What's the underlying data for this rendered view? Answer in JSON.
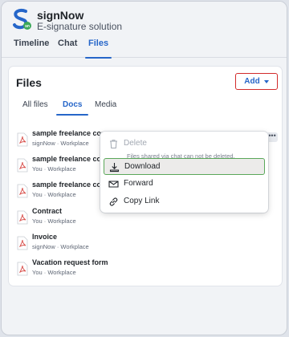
{
  "header": {
    "title": "signNow",
    "subtitle": "E-signature solution",
    "logo_icon": "signnow-logo-icon"
  },
  "tabs": [
    {
      "label": "Timeline",
      "active": false
    },
    {
      "label": "Chat",
      "active": false
    },
    {
      "label": "Files",
      "active": true
    }
  ],
  "files_card": {
    "title": "Files",
    "add_label": "Add",
    "subtabs": [
      {
        "label": "All files",
        "active": false
      },
      {
        "label": "Docs",
        "active": true
      },
      {
        "label": "Media",
        "active": false
      }
    ],
    "files": [
      {
        "name": "sample freelance cor",
        "meta": "signNow · Workplace"
      },
      {
        "name": "sample freelance cor",
        "meta": "You · Workplace"
      },
      {
        "name": "sample freelance cor",
        "meta": "You · Workplace"
      },
      {
        "name": "Contract",
        "meta": "You · Workplace"
      },
      {
        "name": "Invoice",
        "meta": "signNow · Workplace"
      },
      {
        "name": "Vacation request form",
        "meta": "You · Workplace"
      }
    ],
    "more_label": "•••"
  },
  "context_menu": {
    "delete_label": "Delete",
    "delete_note": "Files shared via chat can not be deleted.",
    "download_label": "Download",
    "forward_label": "Forward",
    "copy_link_label": "Copy Link"
  },
  "colors": {
    "accent": "#2666c9",
    "add_border": "#d22b2b",
    "pdf_red": "#d9534f",
    "selected_border": "#5aa85a"
  }
}
